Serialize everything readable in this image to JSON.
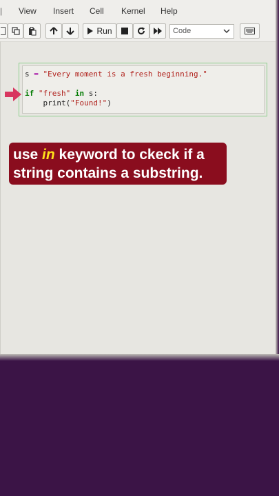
{
  "menu": {
    "items": [
      "View",
      "Insert",
      "Cell",
      "Kernel",
      "Help"
    ]
  },
  "toolbar": {
    "run_label": "Run",
    "cell_type": "Code"
  },
  "cell": {
    "code": {
      "l1_var": "s",
      "l1_eq": "=",
      "l1_str": "\"Every moment is a fresh beginning.\"",
      "l2_if": "if",
      "l2_str": "\"fresh\"",
      "l2_in": "in",
      "l2_rest": "s:",
      "l3_print": "print(",
      "l3_str": "\"Found!\"",
      "l3_close": ")"
    }
  },
  "caption": {
    "part1": "use",
    "highlight": "in",
    "part2": "keyword to ckeck if a",
    "line2": "string contains a substring."
  },
  "colors": {
    "caption_bg": "#8a0d1e",
    "highlight": "#ffe11a",
    "arrow": "#d8365f",
    "cell_border": "#8fd08f",
    "page_bg": "#3b1446"
  }
}
